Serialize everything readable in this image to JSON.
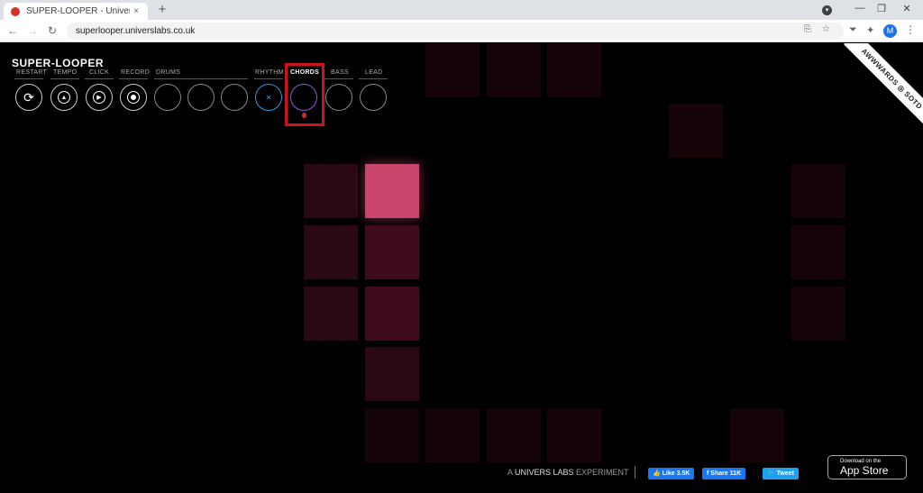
{
  "browser": {
    "tab_title": "SUPER-LOOPER - Univers Labs",
    "tab_close": "×",
    "new_tab": "+",
    "url": "superlooper.universlabs.co.uk",
    "profile_initial": "M",
    "minimize": "—",
    "restore": "❐",
    "close": "✕",
    "back": "←",
    "forward": "→",
    "reload": "↻",
    "translate": "⎘",
    "bookmark": "☆",
    "extension1": "⏷",
    "extensions": "✦",
    "menu": "⋮",
    "profile_dot": "▾"
  },
  "app": {
    "logo": "SUPER-LOOPER",
    "labels": {
      "restart": "RESTART",
      "tempo": "TEMPO",
      "click": "CLICK",
      "record": "RECORD",
      "drums": "DRUMS",
      "rhythm": "RHYTHM",
      "chords": "CHORDS",
      "bass": "BASS",
      "lead": "LEAD"
    },
    "icons": {
      "restart": "⟳",
      "tempo": "▲",
      "click": "▶",
      "rhythm": "✕"
    },
    "active_instrument": "CHORDS",
    "badge": "AWWWARDS ◎ SOTD"
  },
  "footer": {
    "credit_a": "A ",
    "credit_brand": "UNIVERS LABS",
    "credit_suffix": " EXPERIMENT",
    "like": "👍 Like 3.5K",
    "share": "f Share 11K",
    "tweet": "🐦 Tweet",
    "appstore_small": "Download on the",
    "appstore_big": "App Store",
    "apple_glyph": ""
  },
  "colors": {
    "pad_lit": "#c8456b",
    "rhythm_ring": "#2b9ce0",
    "chords_ring": "#8a5bd6",
    "highlight": "#d0121b"
  }
}
